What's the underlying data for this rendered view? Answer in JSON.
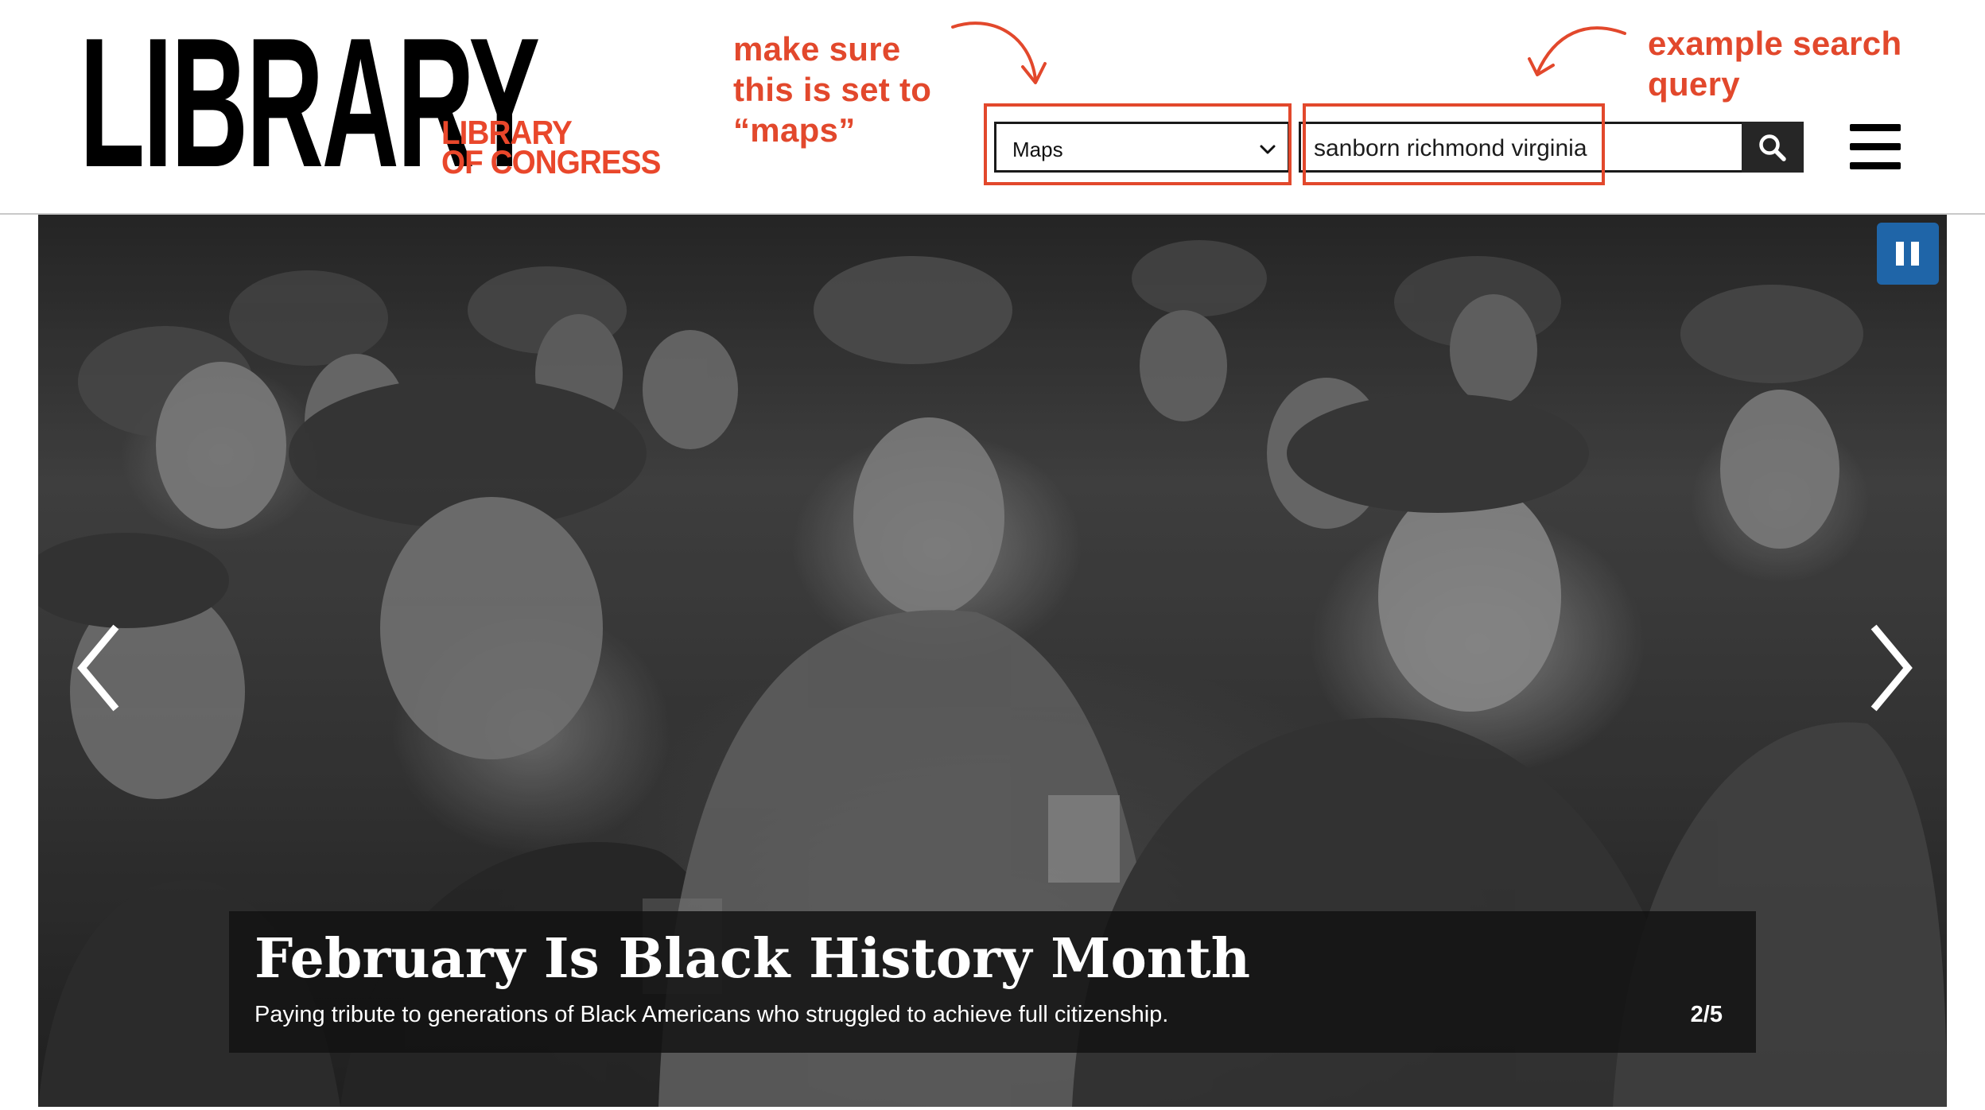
{
  "header": {
    "logo_main": "LIBRARY",
    "logo_sub_line1": "LIBRARY",
    "logo_sub_line2": "OF CONGRESS",
    "annotation_left_line1": "make sure",
    "annotation_left_line2": "this is set to",
    "annotation_left_line3": "“maps”",
    "annotation_right_line1": "example search",
    "annotation_right_line2": "query",
    "search_scope": {
      "selected": "Maps"
    },
    "search_query": "sanborn richmond virginia",
    "search_icon": "magnifier-icon",
    "menu_icon": "hamburger-icon"
  },
  "colors": {
    "brand_red": "#e9472b",
    "annotation_red": "#e2482c",
    "pause_blue": "#1f65a8",
    "search_button": "#262626"
  },
  "carousel": {
    "caption_title": "February Is Black History Month",
    "caption_subtitle": "Paying tribute to generations of Black Americans who struggled to achieve full citizenship.",
    "slide_counter": "2/5",
    "pause_icon": "pause-icon",
    "prev_icon": "chevron-left-icon",
    "next_icon": "chevron-right-icon"
  }
}
